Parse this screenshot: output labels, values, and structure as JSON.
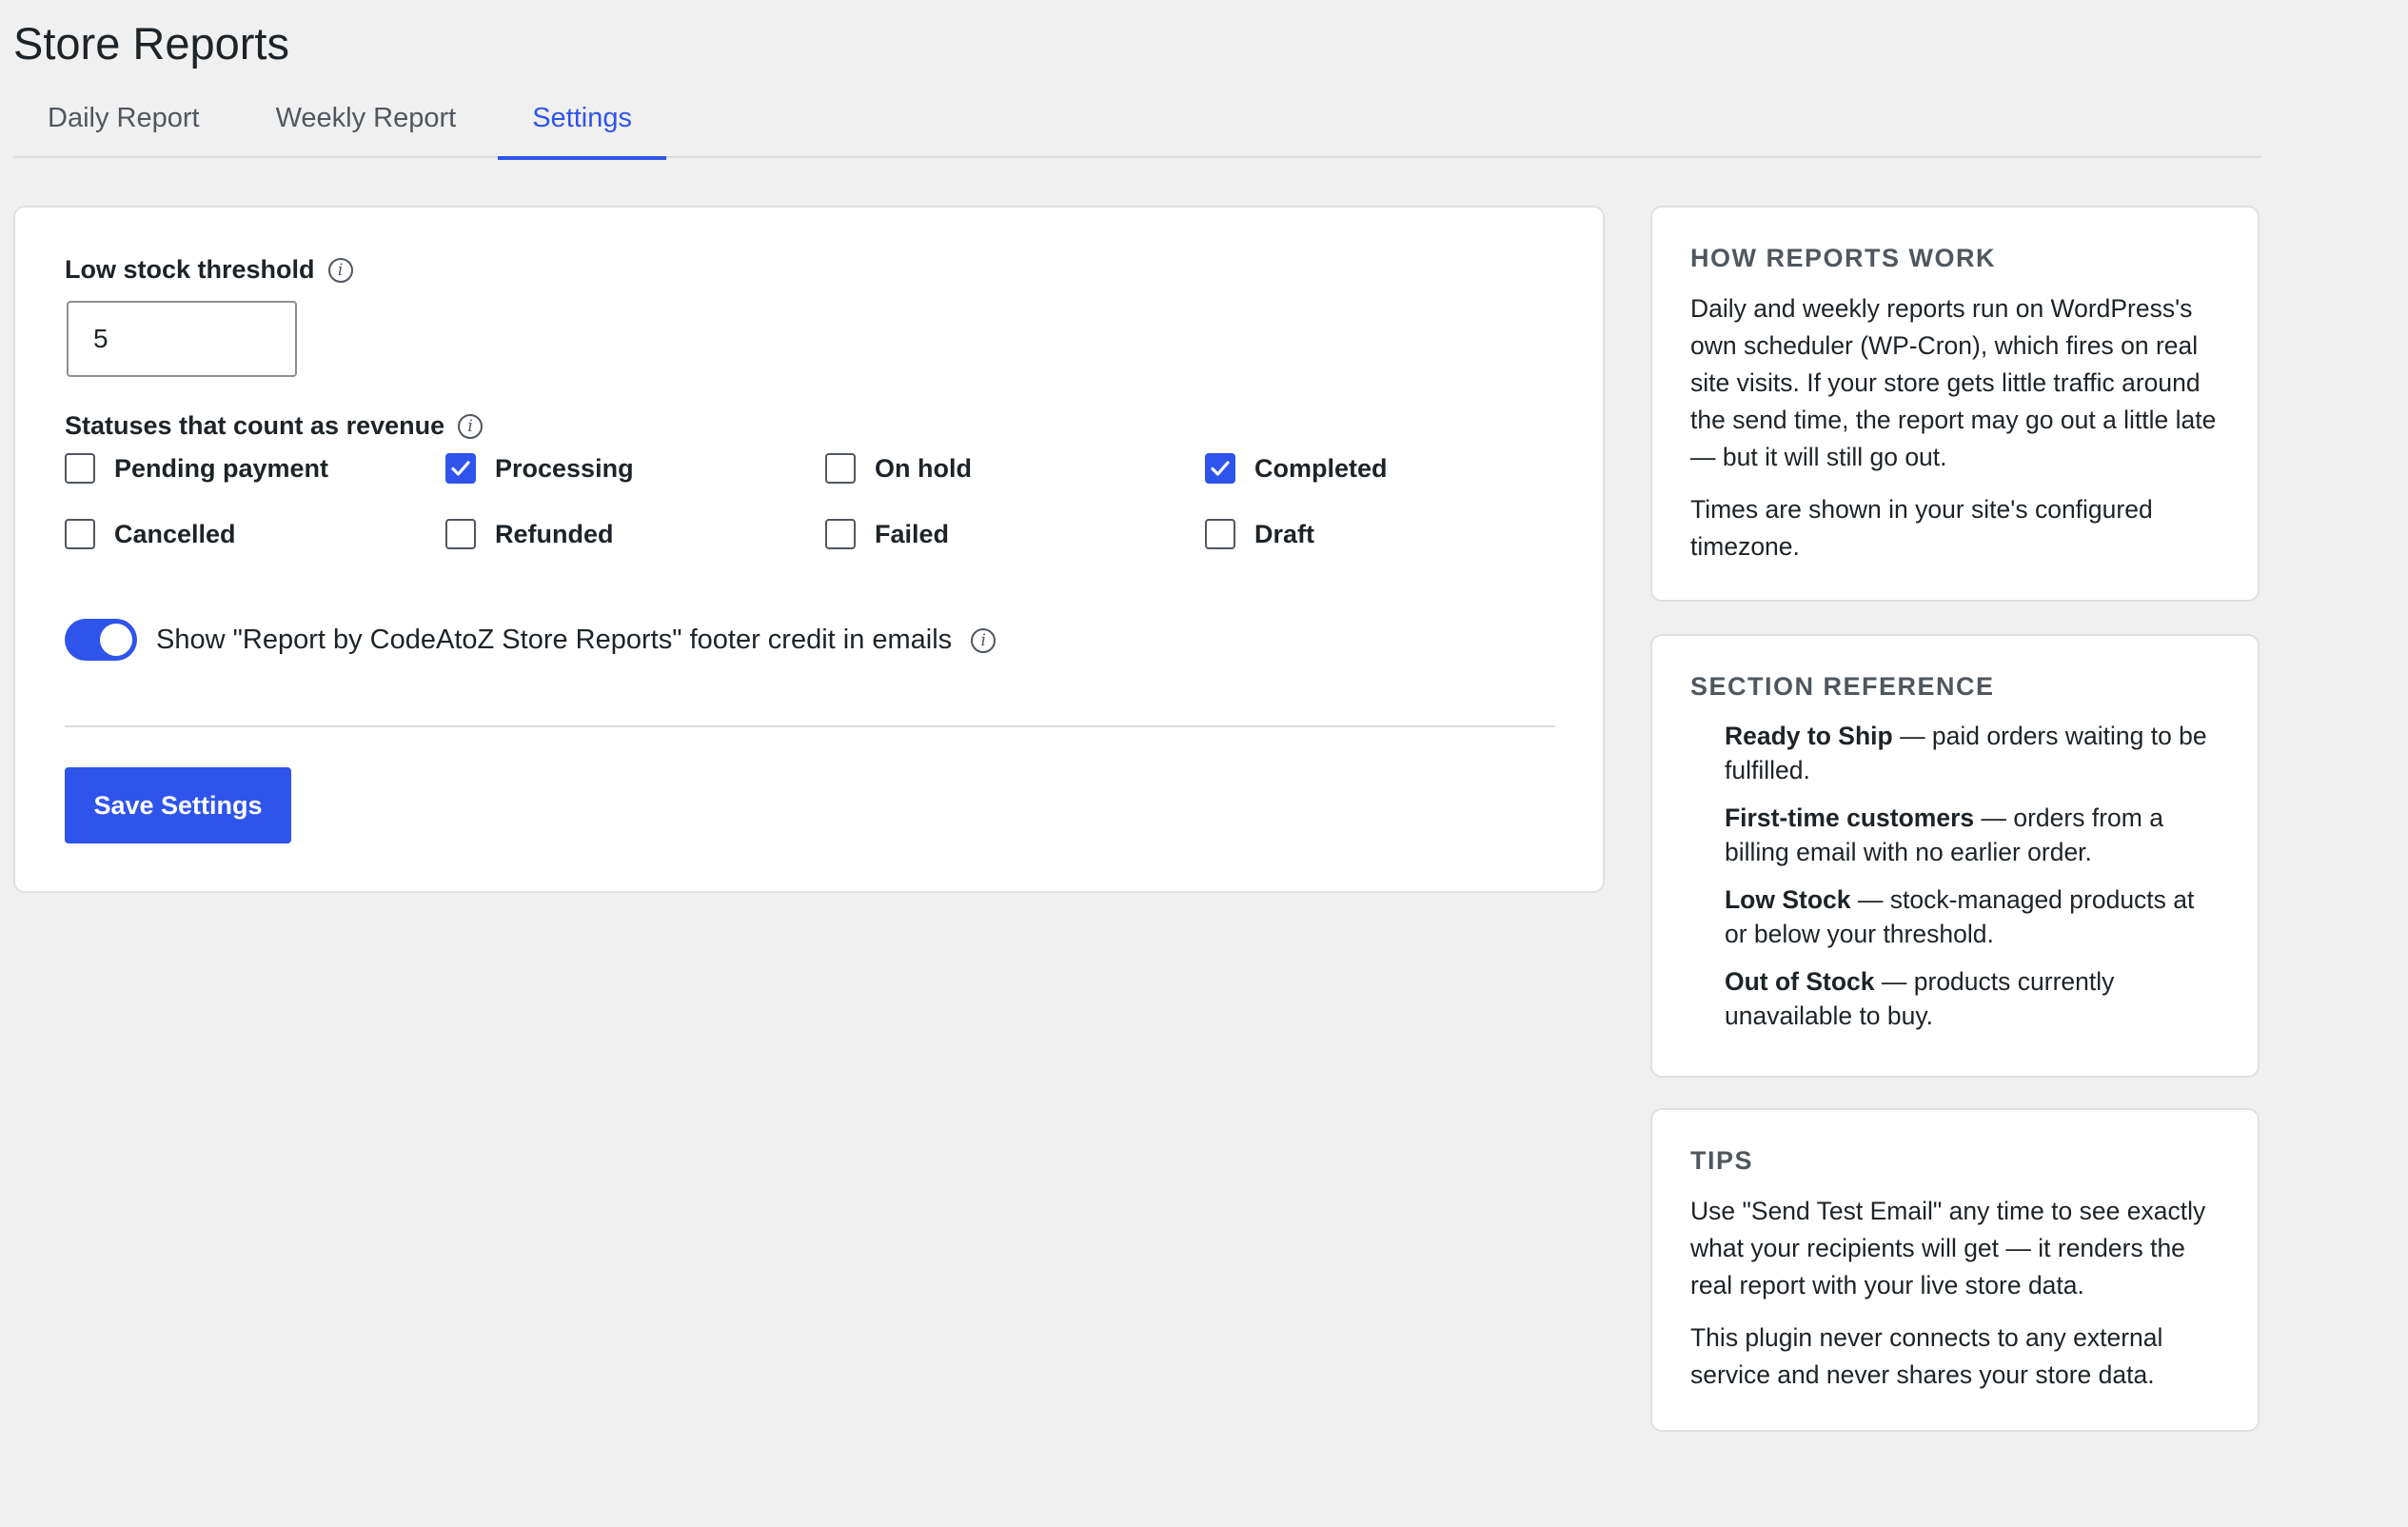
{
  "page": {
    "title": "Store Reports"
  },
  "tabs": [
    {
      "label": "Daily Report",
      "active": false
    },
    {
      "label": "Weekly Report",
      "active": false
    },
    {
      "label": "Settings",
      "active": true
    }
  ],
  "settings": {
    "low_stock": {
      "label": "Low stock threshold",
      "value": "5",
      "info_icon": "info-icon"
    },
    "statuses": {
      "label": "Statuses that count as revenue",
      "items": [
        {
          "label": "Pending payment",
          "checked": false
        },
        {
          "label": "Processing",
          "checked": true
        },
        {
          "label": "On hold",
          "checked": false
        },
        {
          "label": "Completed",
          "checked": true
        },
        {
          "label": "Cancelled",
          "checked": false
        },
        {
          "label": "Refunded",
          "checked": false
        },
        {
          "label": "Failed",
          "checked": false
        },
        {
          "label": "Draft",
          "checked": false
        }
      ]
    },
    "footer_credit": {
      "label": "Show \"Report by CodeAtoZ Store Reports\" footer credit in emails",
      "enabled": true
    },
    "save_label": "Save Settings"
  },
  "sidebar": {
    "how": {
      "title": "HOW REPORTS WORK",
      "p1": "Daily and weekly reports run on WordPress's own scheduler (WP-Cron), which fires on real site visits. If your store gets little traffic around the send time, the report may go out a little late — but it will still go out.",
      "p2": "Times are shown in your site's configured timezone."
    },
    "reference": {
      "title": "SECTION REFERENCE",
      "items": [
        {
          "term": "Ready to Ship",
          "desc": " — paid orders waiting to be fulfilled."
        },
        {
          "term": "First-time customers",
          "desc": " — orders from a billing email with no earlier order."
        },
        {
          "term": "Low Stock",
          "desc": " — stock-managed products at or below your threshold."
        },
        {
          "term": "Out of Stock",
          "desc": " — products currently unavailable to buy."
        }
      ]
    },
    "tips": {
      "title": "TIPS",
      "p1": "Use \"Send Test Email\" any time to see exactly what your recipients will get — it renders the real report with your live store data.",
      "p2": "This plugin never connects to any external service and never shares your store data."
    }
  },
  "colors": {
    "accent": "#2f54eb",
    "background": "#f0f0f1"
  }
}
